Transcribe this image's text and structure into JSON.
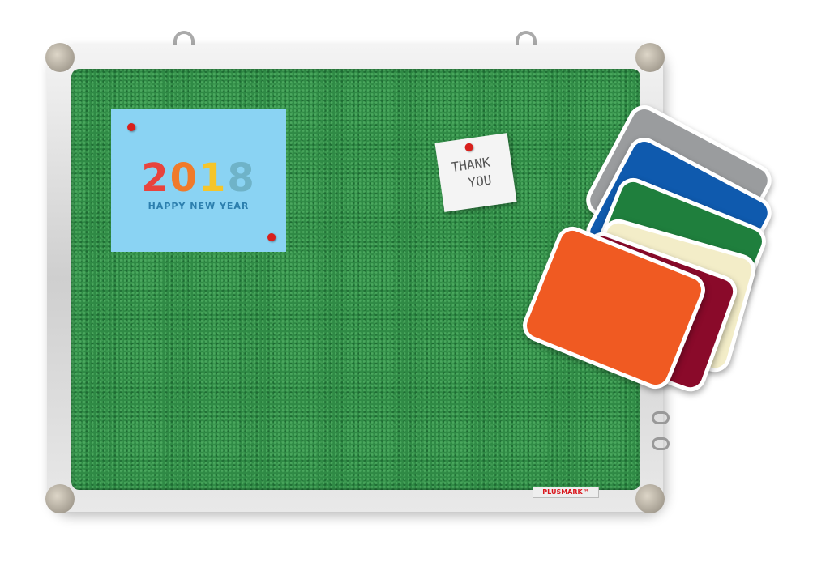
{
  "poster": {
    "year": [
      "2",
      "0",
      "1",
      "8"
    ],
    "caption": "HAPPY NEW YEAR"
  },
  "note": {
    "line1": "THANK",
    "line2": "YOU"
  },
  "brand": {
    "label": "PLUSMARK™"
  },
  "swatches": [
    {
      "name": "grey",
      "color": "#9a9c9e"
    },
    {
      "name": "blue",
      "color": "#0f5aae"
    },
    {
      "name": "green",
      "color": "#1f7f3d"
    },
    {
      "name": "cream",
      "color": "#f3edc8"
    },
    {
      "name": "maroon",
      "color": "#8a0a2a"
    },
    {
      "name": "orange",
      "color": "#f05a22"
    }
  ]
}
